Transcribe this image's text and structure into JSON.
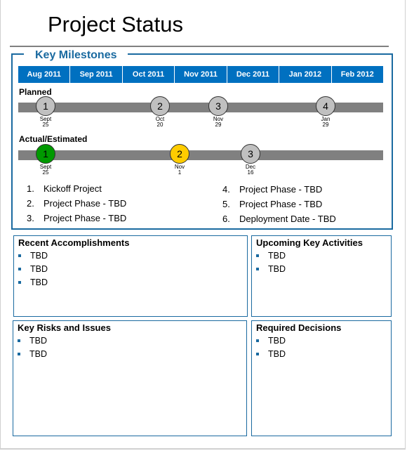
{
  "title": "Project Status",
  "milestones": {
    "heading": "Key Milestones",
    "months": [
      "Aug 2011",
      "Sep 2011",
      "Oct 2011",
      "Nov 2011",
      "Dec 2011",
      "Jan 2012",
      "Feb 2012"
    ],
    "planned": {
      "label": "Planned",
      "items": [
        {
          "num": "1",
          "month": "Sept",
          "day": "25",
          "status": "planned",
          "color": "#c0c0c0"
        },
        {
          "num": "2",
          "month": "Oct",
          "day": "20",
          "status": "planned",
          "color": "#c0c0c0"
        },
        {
          "num": "3",
          "month": "Nov",
          "day": "29",
          "status": "planned",
          "color": "#c0c0c0"
        },
        {
          "num": "4",
          "month": "Jan",
          "day": "29",
          "status": "planned",
          "color": "#c0c0c0"
        }
      ]
    },
    "actual": {
      "label": "Actual/Estimated",
      "items": [
        {
          "num": "1",
          "month": "Sept",
          "day": "25",
          "status": "complete",
          "color": "#009900"
        },
        {
          "num": "2",
          "month": "Nov",
          "day": "1",
          "status": "at-risk",
          "color": "#ffcc00"
        },
        {
          "num": "3",
          "month": "Dec",
          "day": "16",
          "status": "planned",
          "color": "#c0c0c0"
        }
      ]
    },
    "list": [
      {
        "num": "1.",
        "text": "Kickoff Project"
      },
      {
        "num": "2.",
        "text": "Project Phase - TBD"
      },
      {
        "num": "3.",
        "text": "Project Phase - TBD"
      },
      {
        "num": "4.",
        "text": "Project Phase - TBD"
      },
      {
        "num": "5.",
        "text": "Project Phase - TBD"
      },
      {
        "num": "6.",
        "text": "Deployment Date - TBD"
      }
    ]
  },
  "panels": {
    "accomplishments": {
      "title": "Recent Accomplishments",
      "items": [
        "TBD",
        "TBD",
        "TBD"
      ]
    },
    "upcoming": {
      "title": "Upcoming Key Activities",
      "items": [
        "TBD",
        "TBD"
      ]
    },
    "risks": {
      "title": "Key Risks and Issues",
      "items": [
        "TBD",
        "TBD"
      ]
    },
    "decisions": {
      "title": "Required Decisions",
      "items": [
        "TBD",
        "TBD"
      ]
    }
  },
  "colors": {
    "accent": "#0070c0",
    "border": "#1a6aa0",
    "track": "#808080",
    "complete": "#009900",
    "at_risk": "#ffcc00",
    "pending": "#c0c0c0"
  }
}
